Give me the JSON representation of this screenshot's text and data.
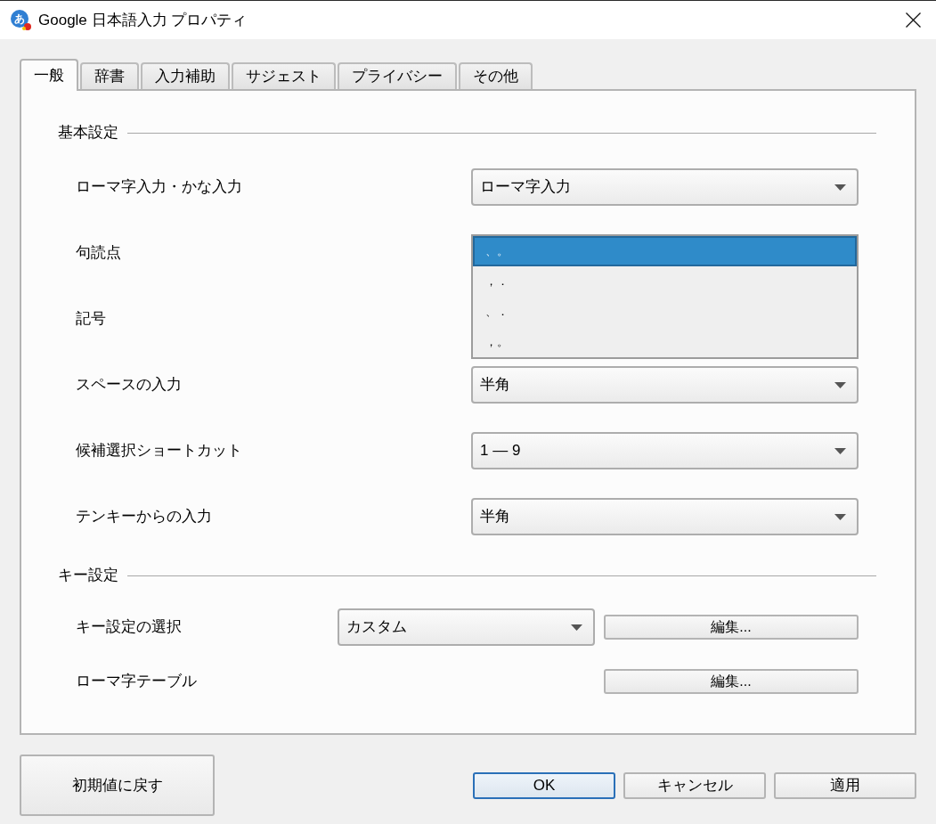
{
  "window": {
    "title": "Google 日本語入力 プロパティ",
    "logo_glyph": "あ"
  },
  "tabs": [
    {
      "label": "一般",
      "selected": true
    },
    {
      "label": "辞書",
      "selected": false
    },
    {
      "label": "入力補助",
      "selected": false
    },
    {
      "label": "サジェスト",
      "selected": false
    },
    {
      "label": "プライバシー",
      "selected": false
    },
    {
      "label": "その他",
      "selected": false
    }
  ],
  "sections": [
    {
      "title": "基本設定",
      "rows": [
        {
          "kind": "dropdown",
          "label": "ローマ字入力・かな入力",
          "value": "ローマ字入力"
        },
        {
          "kind": "open_dropdown",
          "label": "句読点",
          "options": [
            {
              "label": "、。",
              "selected": true
            },
            {
              "label": "，．",
              "selected": false
            },
            {
              "label": "、．",
              "selected": false
            },
            {
              "label": "，。",
              "selected": false
            }
          ]
        },
        {
          "kind": "covered",
          "label": "記号"
        },
        {
          "kind": "dropdown",
          "label": "スペースの入力",
          "value": "半角"
        },
        {
          "kind": "dropdown",
          "label": "候補選択ショートカット",
          "value": "1 — 9"
        },
        {
          "kind": "dropdown",
          "label": "テンキーからの入力",
          "value": "半角"
        }
      ]
    },
    {
      "title": "キー設定",
      "rows": [
        {
          "kind": "dropdown_button",
          "label": "キー設定の選択",
          "value": "カスタム",
          "button": "編集..."
        },
        {
          "kind": "button",
          "label": "ローマ字テーブル",
          "button": "編集..."
        }
      ]
    }
  ],
  "footer": {
    "reset": "初期値に戻す",
    "actions": [
      {
        "label": "OK",
        "default": true
      },
      {
        "label": "キャンセル",
        "default": false
      },
      {
        "label": "適用",
        "default": false
      }
    ]
  }
}
